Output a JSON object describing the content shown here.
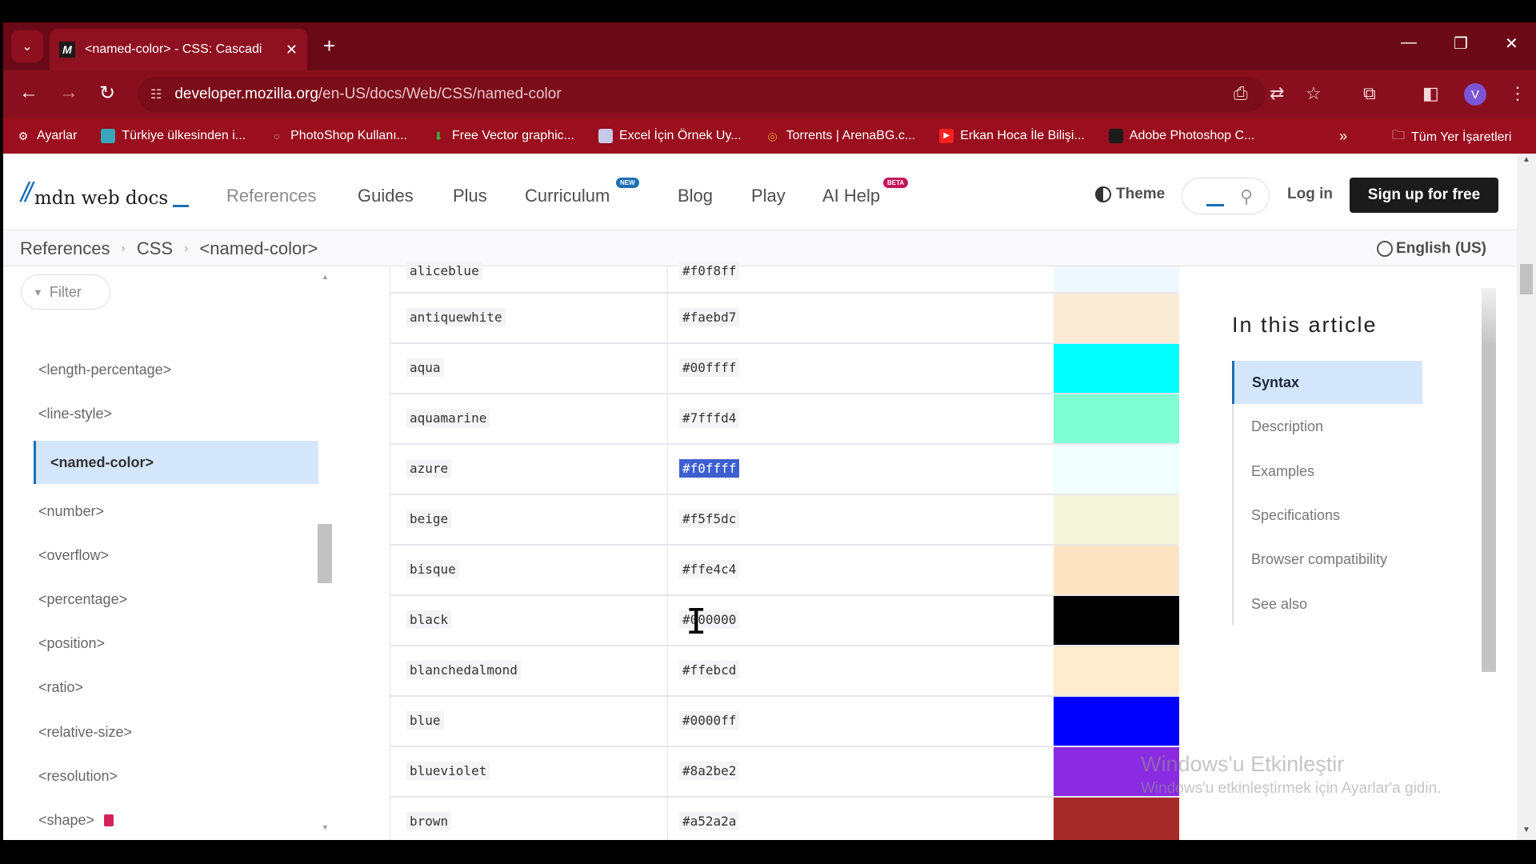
{
  "browser": {
    "tab": {
      "title": "<named-color> - CSS: Cascadi",
      "favicon": "M"
    },
    "url": {
      "host": "developer.mozilla.org",
      "path": "/en-US/docs/Web/CSS/named-color"
    },
    "profile_initial": "V",
    "bookmarks": [
      {
        "label": "Ayarlar",
        "icon": "gear-icon",
        "color": "#ffffff"
      },
      {
        "label": "Türkiye ülkesinden i...",
        "icon": "site-icon",
        "color": "#3aa6b9"
      },
      {
        "label": "PhotoShop Kullanı...",
        "icon": "site-icon",
        "color": "#c9a0a0"
      },
      {
        "label": "Free Vector graphic...",
        "icon": "download-arrow-icon",
        "color": "#3cb043"
      },
      {
        "label": "Excel İçin Örnek Uy...",
        "icon": "site-icon",
        "color": "#c8c8e8"
      },
      {
        "label": "Torrents | ArenaBG.c...",
        "icon": "site-icon",
        "color": "#f0a020"
      },
      {
        "label": "Erkan Hoca İle Bilişi...",
        "icon": "youtube-icon",
        "color": "#ff2020"
      },
      {
        "label": "Adobe Photoshop C...",
        "icon": "site-icon",
        "color": "#1b1b1b"
      }
    ],
    "bookmarks_more": "»",
    "all_bookmarks": "Tüm Yer İşaretleri"
  },
  "header": {
    "logo_text": "mdn web docs",
    "nav": [
      {
        "label": "References"
      },
      {
        "label": "Guides"
      },
      {
        "label": "Plus"
      },
      {
        "label": "Curriculum",
        "badge": "NEW",
        "badge_color": "#1b6fb5"
      },
      {
        "label": "Blog"
      },
      {
        "label": "Play"
      },
      {
        "label": "AI Help",
        "badge": "BETA",
        "badge_color": "#c4155b"
      }
    ],
    "theme": "Theme",
    "login": "Log in",
    "signup": "Sign up for free"
  },
  "breadcrumbs": [
    "References",
    "CSS",
    "<named-color>"
  ],
  "language": "English (US)",
  "sidebar": {
    "filter_placeholder": "Filter",
    "items": [
      "<length-percentage>",
      "<line-style>",
      "<named-color>",
      "<number>",
      "<overflow>",
      "<percentage>",
      "<position>",
      "<ratio>",
      "<relative-size>",
      "<resolution>",
      "<shape>"
    ],
    "active": "<named-color>",
    "deprecated_item": "<shape>"
  },
  "colors_table": {
    "rows": [
      {
        "name": "aliceblue",
        "hex": "#f0f8ff"
      },
      {
        "name": "antiquewhite",
        "hex": "#faebd7"
      },
      {
        "name": "aqua",
        "hex": "#00ffff"
      },
      {
        "name": "aquamarine",
        "hex": "#7fffd4"
      },
      {
        "name": "azure",
        "hex": "#f0ffff",
        "selected": true
      },
      {
        "name": "beige",
        "hex": "#f5f5dc"
      },
      {
        "name": "bisque",
        "hex": "#ffe4c4"
      },
      {
        "name": "black",
        "hex": "#000000"
      },
      {
        "name": "blanchedalmond",
        "hex": "#ffebcd"
      },
      {
        "name": "blue",
        "hex": "#0000ff"
      },
      {
        "name": "blueviolet",
        "hex": "#8a2be2"
      },
      {
        "name": "brown",
        "hex": "#a52a2a"
      }
    ]
  },
  "toc": {
    "title": "In this article",
    "items": [
      "Syntax",
      "Description",
      "Examples",
      "Specifications",
      "Browser compatibility",
      "See also"
    ],
    "active": "Syntax"
  },
  "watermark": {
    "title": "Windows'u Etkinleştir",
    "subtitle": "Windows'u etkinleştirmek için Ayarlar'a gidin."
  }
}
